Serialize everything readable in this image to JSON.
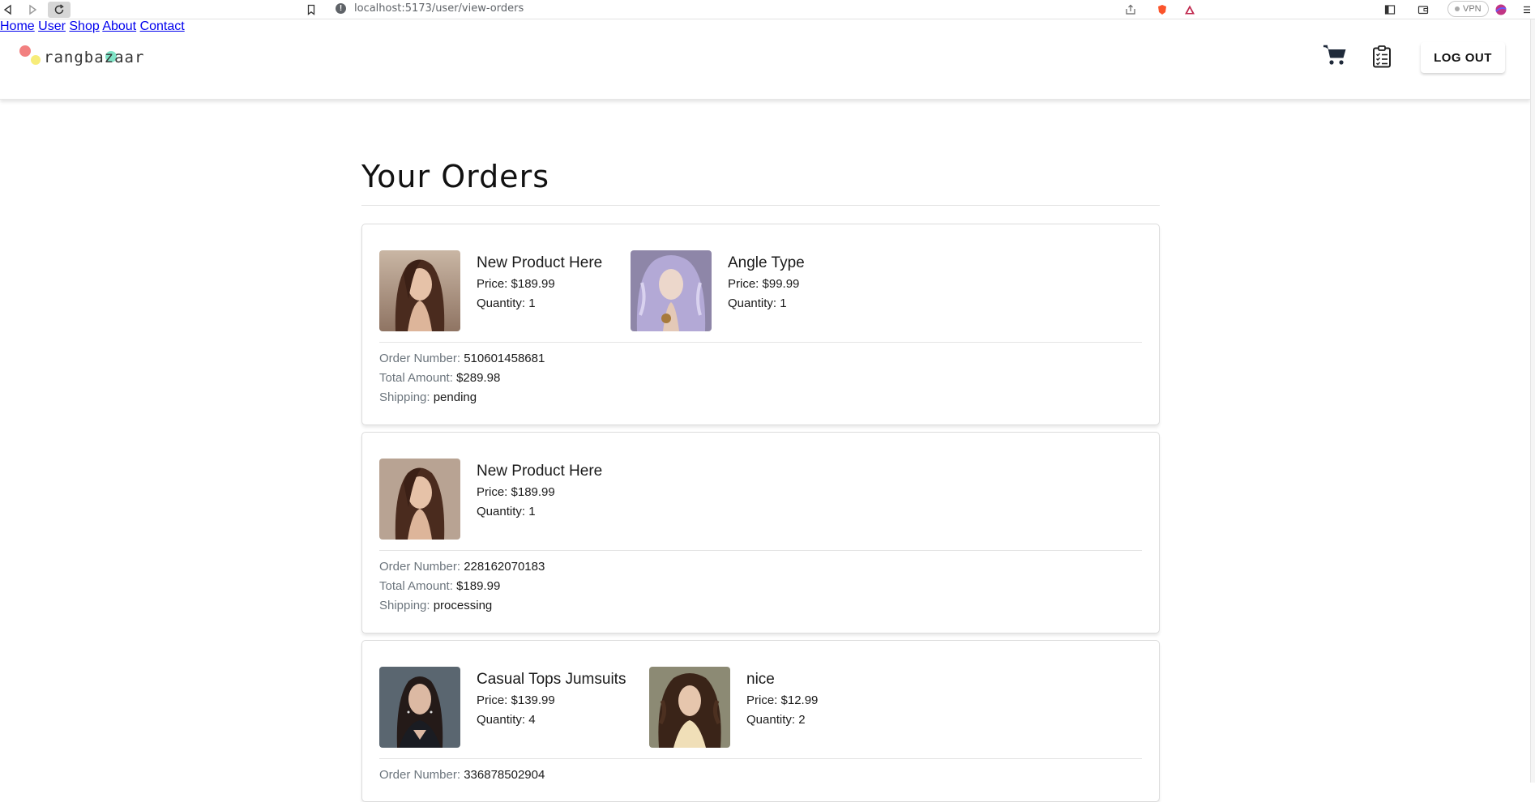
{
  "browser": {
    "url": "localhost:5173/user/view-orders",
    "vpn_label": "VPN"
  },
  "header": {
    "logo_text": "rangbazaar",
    "nav": [
      "Home",
      "User",
      "Shop",
      "About",
      "Contact"
    ],
    "logout_label": "LOG OUT"
  },
  "page": {
    "title": "Your Orders"
  },
  "labels": {
    "price": "Price: ",
    "quantity": "Quantity: ",
    "order_number": "Order Number: ",
    "total_amount": "Total Amount: ",
    "shipping": "Shipping: "
  },
  "orders": [
    {
      "items": [
        {
          "name": "New Product Here",
          "price": "$189.99",
          "quantity": "1"
        },
        {
          "name": "Angle Type",
          "price": "$99.99",
          "quantity": "1"
        }
      ],
      "order_number": "510601458681",
      "total_amount": "$289.98",
      "shipping": "pending"
    },
    {
      "items": [
        {
          "name": "New Product Here",
          "price": "$189.99",
          "quantity": "1"
        }
      ],
      "order_number": "228162070183",
      "total_amount": "$189.99",
      "shipping": "processing"
    },
    {
      "items": [
        {
          "name": "Casual Tops Jumsuits",
          "price": "$139.99",
          "quantity": "4"
        },
        {
          "name": "nice",
          "price": "$12.99",
          "quantity": "2"
        }
      ],
      "order_number": "336878502904",
      "total_amount": "",
      "shipping": ""
    }
  ]
}
